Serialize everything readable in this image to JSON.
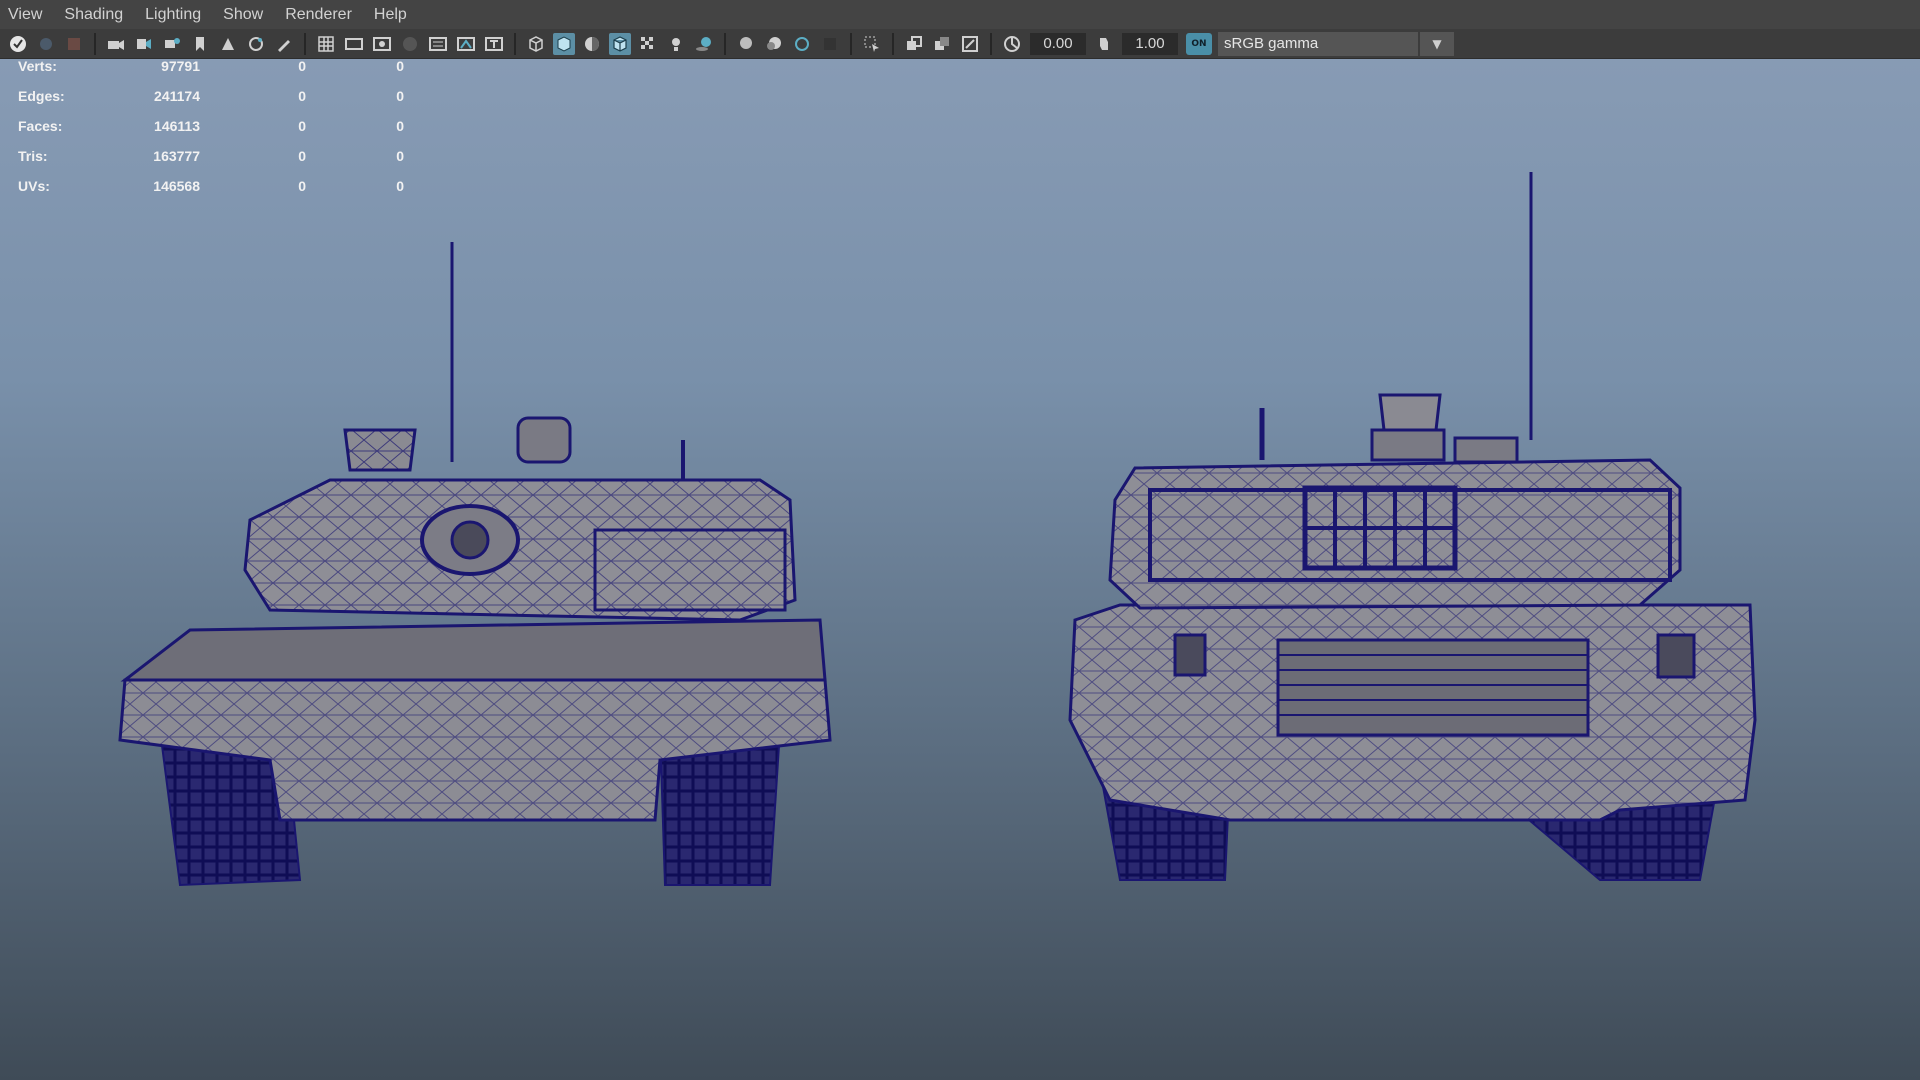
{
  "menu": [
    "View",
    "Shading",
    "Lighting",
    "Show",
    "Renderer",
    "Help"
  ],
  "toolbar": {
    "exposure_value": "0.00",
    "gamma_value": "1.00",
    "color_mgmt_toggle": "ON",
    "color_space": "sRGB gamma"
  },
  "hud": {
    "rows": [
      {
        "label": "Verts:",
        "v1": "97791",
        "v2": "0",
        "v3": "0"
      },
      {
        "label": "Edges:",
        "v1": "241174",
        "v2": "0",
        "v3": "0"
      },
      {
        "label": "Faces:",
        "v1": "146113",
        "v2": "0",
        "v3": "0"
      },
      {
        "label": "Tris:",
        "v1": "163777",
        "v2": "0",
        "v3": "0"
      },
      {
        "label": "UVs:",
        "v1": "146568",
        "v2": "0",
        "v3": "0"
      }
    ]
  },
  "colors": {
    "wire": "#1a1670",
    "fill": "#8e8e96",
    "accent": "#5c8fa5"
  }
}
